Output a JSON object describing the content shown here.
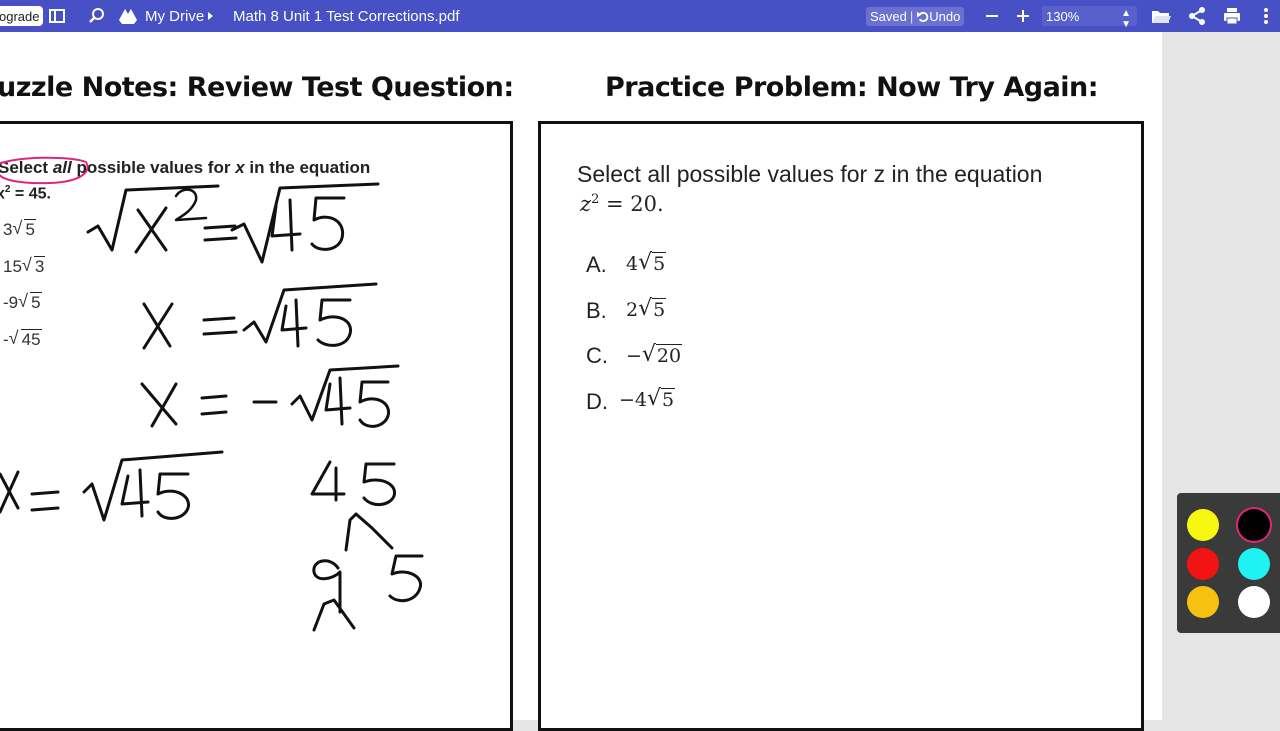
{
  "toolbar": {
    "upgrade_label": "ograde",
    "breadcrumb_root": "My Drive",
    "file_name": "Math 8 Unit 1 Test Corrections.pdf",
    "saved_label": "Saved",
    "undo_label": "Undo",
    "zoom_value": "130%",
    "icons": [
      "sidebar-toggle-icon",
      "search-icon",
      "drive-icon",
      "chevron-right-icon",
      "undo-icon",
      "zoom-out-icon",
      "zoom-in-icon",
      "folder-open-icon",
      "share-icon",
      "print-icon",
      "more-icon"
    ]
  },
  "document": {
    "left_heading": "uzzle Notes: Review Test Question:",
    "right_heading": "Practice Problem: Now Try Again:",
    "original_question": {
      "select": "Select",
      "all": "all",
      "rest": "possible values for",
      "var": "x",
      "tail": "in the equation",
      "equation": "x",
      "equation_exp": "2",
      "equation_rest": "= 45.",
      "choices": [
        {
          "coef": "3",
          "rad": "5"
        },
        {
          "coef": "15",
          "rad": "3"
        },
        {
          "coef": "-9",
          "rad": "5"
        },
        {
          "coef": "-",
          "rad": "45"
        }
      ]
    },
    "practice": {
      "prompt": "Select all possible values for z in the equation",
      "eq_var": "z",
      "eq_exp": "2",
      "eq_rest": " = 20.",
      "options": [
        {
          "letter": "A.",
          "coef": "4",
          "rad": "5"
        },
        {
          "letter": "B.",
          "coef": "2",
          "rad": "5"
        },
        {
          "letter": "C.",
          "coef": "−",
          "rad": "20"
        },
        {
          "letter": "D.",
          "coef": "−4",
          "rad": "5"
        }
      ]
    }
  },
  "palette": {
    "colors": [
      "#f7f711",
      "#000000",
      "#f21414",
      "#1ef2f2",
      "#f5c212",
      "#ffffff"
    ],
    "selected": "#000000"
  }
}
